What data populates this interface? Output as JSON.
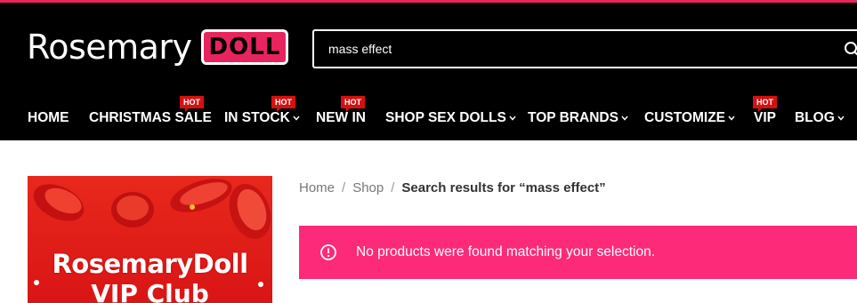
{
  "header": {
    "logo_text": "Rosemary",
    "logo_badge": "DOLL",
    "search": {
      "value": "mass effect",
      "placeholder": ""
    }
  },
  "nav": {
    "items": [
      {
        "label": "HOME",
        "hot": false,
        "dropdown": false
      },
      {
        "label": "CHRISTMAS SALE",
        "hot": true,
        "dropdown": false
      },
      {
        "label": "IN STOCK",
        "hot": true,
        "dropdown": true
      },
      {
        "label": "NEW IN",
        "hot": true,
        "dropdown": false
      },
      {
        "label": "SHOP SEX DOLLS",
        "hot": false,
        "dropdown": true
      },
      {
        "label": "TOP BRANDS",
        "hot": false,
        "dropdown": true
      },
      {
        "label": "CUSTOMIZE",
        "hot": false,
        "dropdown": true
      },
      {
        "label": "VIP",
        "hot": true,
        "dropdown": false
      },
      {
        "label": "BLOG",
        "hot": false,
        "dropdown": true
      }
    ],
    "hot_label": "HOT"
  },
  "sidebar": {
    "banner": {
      "title": "RosemaryDoll",
      "subtitle": "VIP Club"
    }
  },
  "breadcrumb": {
    "home": "Home",
    "shop": "Shop",
    "current": "Search results for “mass effect”",
    "separator": "/"
  },
  "notice": {
    "text": "No products were found matching your selection."
  },
  "colors": {
    "accent": "#e8245f",
    "notice_bg": "#fc2a78",
    "hot_badge": "#d41111",
    "header_bg": "#000000"
  }
}
